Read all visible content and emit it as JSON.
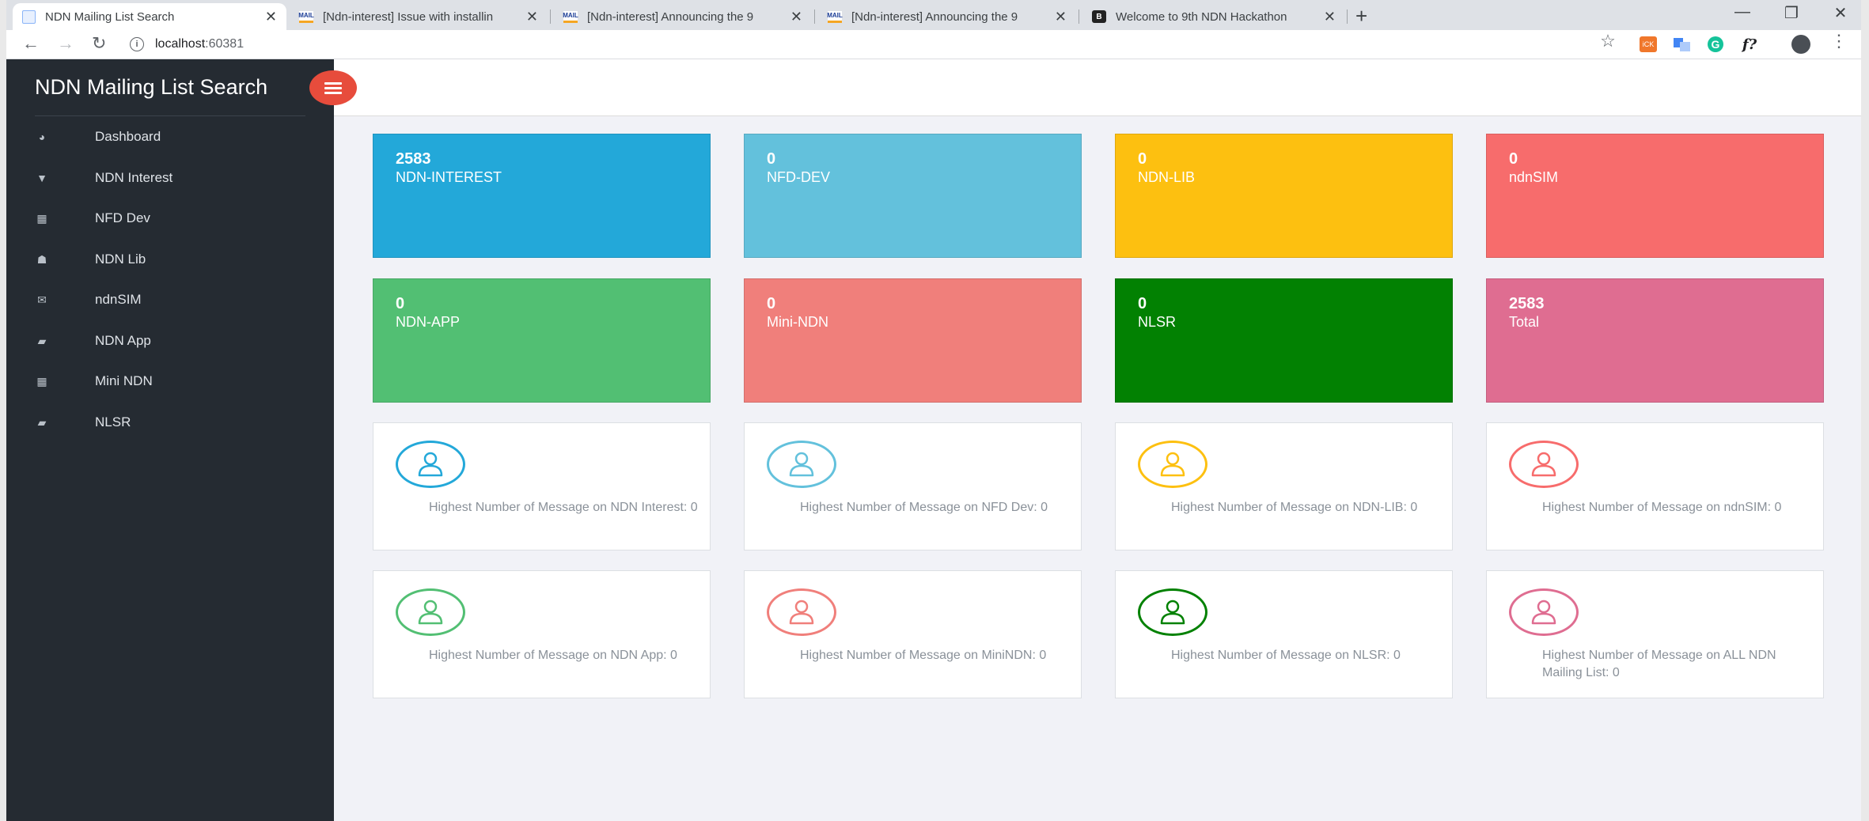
{
  "browser": {
    "tabs": [
      {
        "title": "NDN Mailing List Search",
        "favicon": "page-icon",
        "active": true
      },
      {
        "title": "[Ndn-interest] Issue with installin",
        "favicon": "mailman-icon",
        "active": false
      },
      {
        "title": "[Ndn-interest] Announcing the 9",
        "favicon": "mailman-icon",
        "active": false
      },
      {
        "title": "[Ndn-interest] Announcing the 9",
        "favicon": "mailman-icon",
        "active": false
      },
      {
        "title": "Welcome to 9th NDN Hackathon",
        "favicon": "bootstrap-icon",
        "active": false
      }
    ],
    "favicon_glyphs": {
      "mail": "MAIL",
      "boot": "B"
    },
    "new_tab": "+",
    "close_glyph": "✕",
    "window_controls": {
      "minimize": "—",
      "restore": "❐",
      "close": "✕"
    },
    "nav": {
      "back": "←",
      "forward": "→",
      "reload": "↻"
    },
    "url_info": "i",
    "url_host": "localhost",
    "url_port": ":60381",
    "bookmark_glyph": "☆",
    "extensions": [
      "iCK",
      "G",
      "f?"
    ],
    "menu_glyph": "⋮"
  },
  "sidebar": {
    "brand": "NDN Mailing List Search",
    "items": [
      {
        "label": "Dashboard",
        "icon": "dashboard-icon",
        "glyph": "◕"
      },
      {
        "label": "NDN Interest",
        "icon": "cocktail-icon",
        "glyph": "▼"
      },
      {
        "label": "NFD Dev",
        "icon": "table-icon",
        "glyph": "▦"
      },
      {
        "label": "NDN Lib",
        "icon": "sitemap-icon",
        "glyph": "☗"
      },
      {
        "label": "ndnSIM",
        "icon": "envelope-icon",
        "glyph": "✉"
      },
      {
        "label": "NDN App",
        "icon": "book-icon",
        "glyph": "▰"
      },
      {
        "label": "Mini NDN",
        "icon": "table-icon",
        "glyph": "▦"
      },
      {
        "label": "NLSR",
        "icon": "book-icon",
        "glyph": "▰"
      }
    ]
  },
  "tiles": [
    {
      "value": "2583",
      "label": "NDN-INTEREST",
      "color": "#23a8d9"
    },
    {
      "value": "0",
      "label": "NFD-DEV",
      "color": "#63c1dc"
    },
    {
      "value": "0",
      "label": "NDN-LIB",
      "color": "#fdc010"
    },
    {
      "value": "0",
      "label": "ndnSIM",
      "color": "#f76c6c"
    },
    {
      "value": "0",
      "label": "NDN-APP",
      "color": "#52bf73"
    },
    {
      "value": "0",
      "label": "Mini-NDN",
      "color": "#f07f7b"
    },
    {
      "value": "0",
      "label": "NLSR",
      "color": "#028102"
    },
    {
      "value": "2583",
      "label": "Total",
      "color": "#df6d91"
    }
  ],
  "stats": [
    {
      "text": "Highest Number of Message on NDN Interest: 0",
      "color": "#23a8d9"
    },
    {
      "text": "Highest Number of Message on NFD Dev: 0",
      "color": "#63c1dc"
    },
    {
      "text": "Highest Number of Message on NDN-LIB: 0",
      "color": "#fdc010"
    },
    {
      "text": "Highest Number of Message on ndnSIM: 0",
      "color": "#f76c6c"
    },
    {
      "text": "Highest Number of Message on NDN App: 0",
      "color": "#52bf73"
    },
    {
      "text": "Highest Number of Message on MiniNDN: 0",
      "color": "#f07f7b"
    },
    {
      "text": "Highest Number of Message on NLSR: 0",
      "color": "#028102"
    },
    {
      "text": "Highest Number of Message on ALL NDN Mailing List: 0",
      "color": "#df6d91"
    }
  ]
}
